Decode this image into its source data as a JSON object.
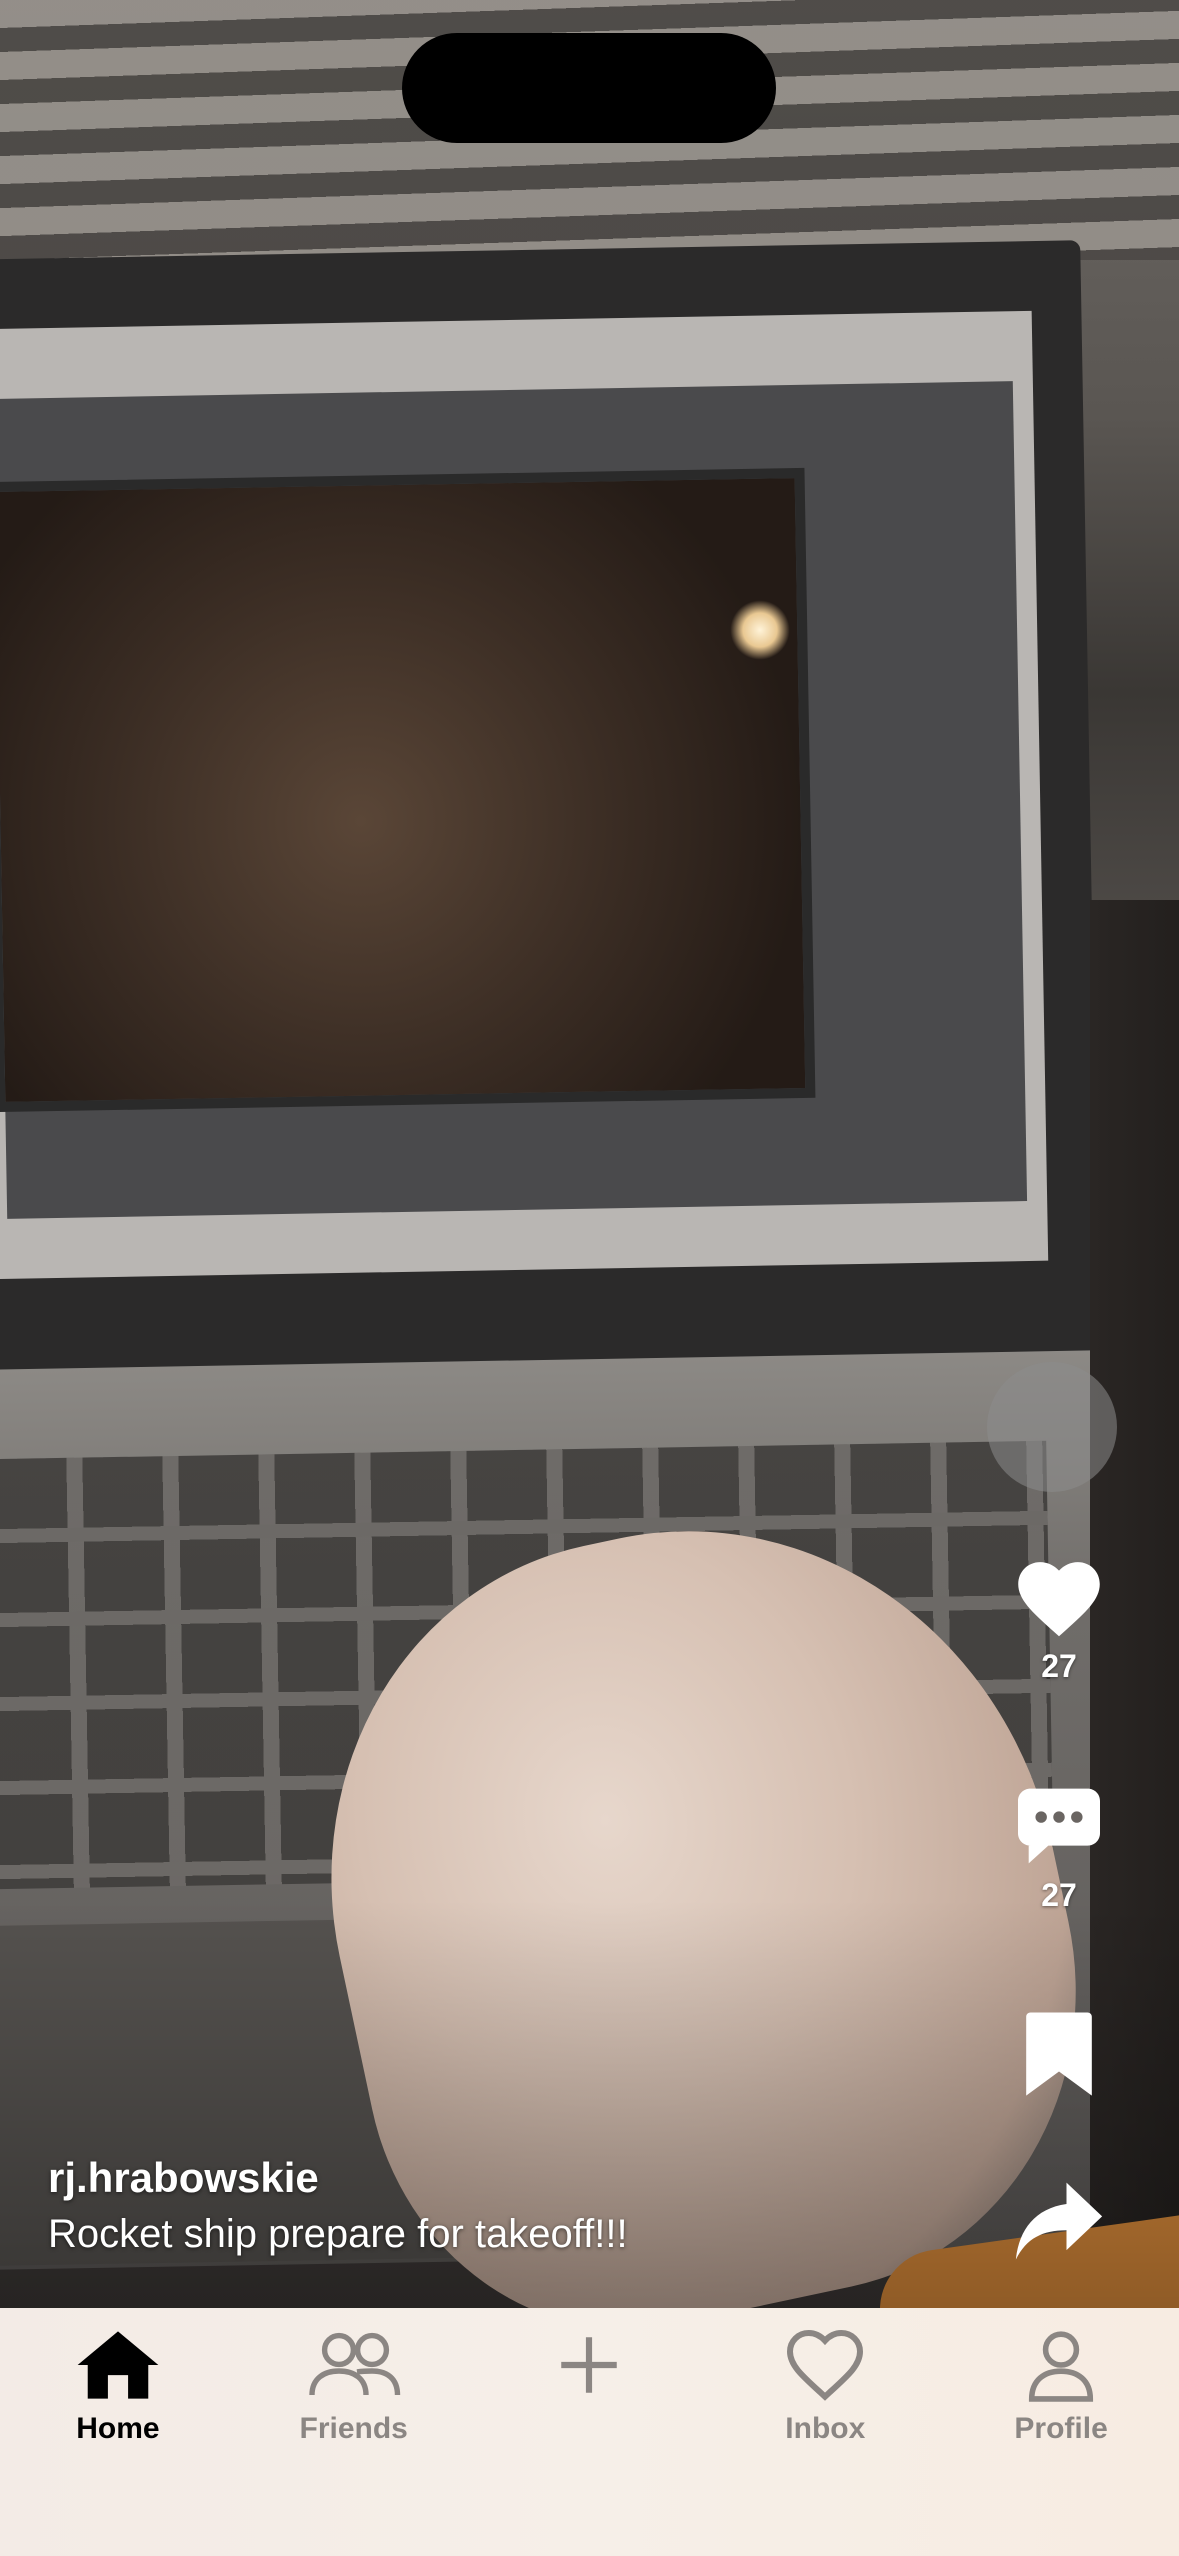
{
  "video": {
    "username": "rj.hrabowskie",
    "caption": "Rocket ship prepare for takeoff!!!"
  },
  "actions": {
    "like_count": "27",
    "comment_count": "27"
  },
  "tabs": [
    {
      "label": "Home",
      "icon": "home-icon",
      "active": true
    },
    {
      "label": "Friends",
      "icon": "friends-icon",
      "active": false
    },
    {
      "label": "",
      "icon": "plus-icon",
      "active": false
    },
    {
      "label": "Inbox",
      "icon": "heart-icon",
      "active": false
    },
    {
      "label": "Profile",
      "icon": "person-icon",
      "active": false
    }
  ],
  "colors": {
    "tabbar_bg": "#f5eee8",
    "tab_active": "#000000",
    "tab_inactive": "#8b8683",
    "action_icon": "#ffffff"
  }
}
